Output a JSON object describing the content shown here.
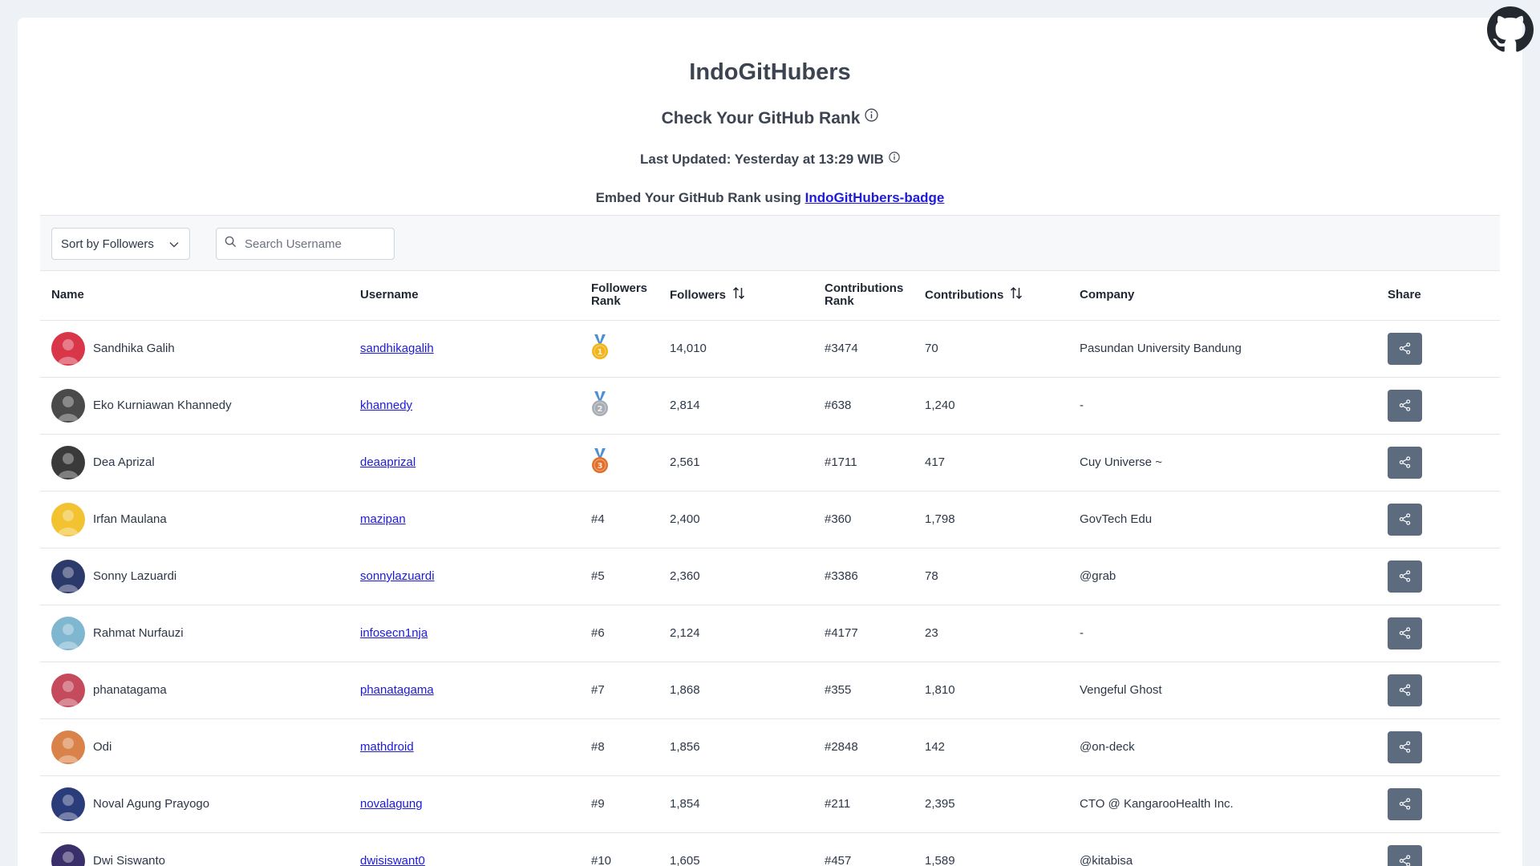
{
  "header": {
    "title": "IndoGitHubers",
    "subtitle": "Check Your GitHub Rank",
    "last_updated": "Last Updated: Yesterday at 13:29 WIB",
    "embed_text": "Embed Your GitHub Rank using ",
    "embed_link": "IndoGitHubers-badge"
  },
  "toolbar": {
    "sort_value": "Sort by Followers",
    "search_placeholder": "Search Username"
  },
  "table": {
    "columns": {
      "name": "Name",
      "username": "Username",
      "followers_rank_1": "Followers",
      "followers_rank_2": "Rank",
      "followers": "Followers",
      "contrib_rank_1": "Contributions",
      "contrib_rank_2": "Rank",
      "contributions": "Contributions",
      "company": "Company",
      "share": "Share"
    },
    "rows": [
      {
        "name": "Sandhika Galih",
        "username": "sandhikagalih",
        "followers_rank": "1",
        "followers": "14,010",
        "contrib_rank": "#3474",
        "contributions": "70",
        "company": "Pasundan University Bandung",
        "avatar_color": "#d9364a"
      },
      {
        "name": "Eko Kurniawan Khannedy",
        "username": "khannedy",
        "followers_rank": "2",
        "followers": "2,814",
        "contrib_rank": "#638",
        "contributions": "1,240",
        "company": "-",
        "avatar_color": "#4a4a4a"
      },
      {
        "name": "Dea Aprizal",
        "username": "deaaprizal",
        "followers_rank": "3",
        "followers": "2,561",
        "contrib_rank": "#1711",
        "contributions": "417",
        "company": "Cuy Universe ~",
        "avatar_color": "#3a3a3a"
      },
      {
        "name": "Irfan Maulana",
        "username": "mazipan",
        "followers_rank": "#4",
        "followers": "2,400",
        "contrib_rank": "#360",
        "contributions": "1,798",
        "company": "GovTech Edu",
        "avatar_color": "#f2c230"
      },
      {
        "name": "Sonny Lazuardi",
        "username": "sonnylazuardi",
        "followers_rank": "#5",
        "followers": "2,360",
        "contrib_rank": "#3386",
        "contributions": "78",
        "company": "@grab",
        "avatar_color": "#2b3a6b"
      },
      {
        "name": "Rahmat Nurfauzi",
        "username": "infosecn1nja",
        "followers_rank": "#6",
        "followers": "2,124",
        "contrib_rank": "#4177",
        "contributions": "23",
        "company": "-",
        "avatar_color": "#7fb6d0"
      },
      {
        "name": "phanatagama",
        "username": "phanatagama",
        "followers_rank": "#7",
        "followers": "1,868",
        "contrib_rank": "#355",
        "contributions": "1,810",
        "company": "Vengeful Ghost",
        "avatar_color": "#c44a5c"
      },
      {
        "name": "Odi",
        "username": "mathdroid",
        "followers_rank": "#8",
        "followers": "1,856",
        "contrib_rank": "#2848",
        "contributions": "142",
        "company": "@on-deck",
        "avatar_color": "#d9834a"
      },
      {
        "name": "Noval Agung Prayogo",
        "username": "novalagung",
        "followers_rank": "#9",
        "followers": "1,854",
        "contrib_rank": "#211",
        "contributions": "2,395",
        "company": "CTO @ KangarooHealth Inc.",
        "avatar_color": "#2a3c7a"
      },
      {
        "name": "Dwi Siswanto",
        "username": "dwisiswant0",
        "followers_rank": "#10",
        "followers": "1,605",
        "contrib_rank": "#457",
        "contributions": "1,589",
        "company": "@kitabisa",
        "avatar_color": "#3b2f6b"
      }
    ]
  },
  "colors": {
    "gold": "#f1b41a",
    "silver": "#a8adb5",
    "bronze": "#e0702a",
    "ribbon": "#4f8fd6",
    "share_button": "#5d6b7f",
    "link": "#1d1ad9"
  }
}
